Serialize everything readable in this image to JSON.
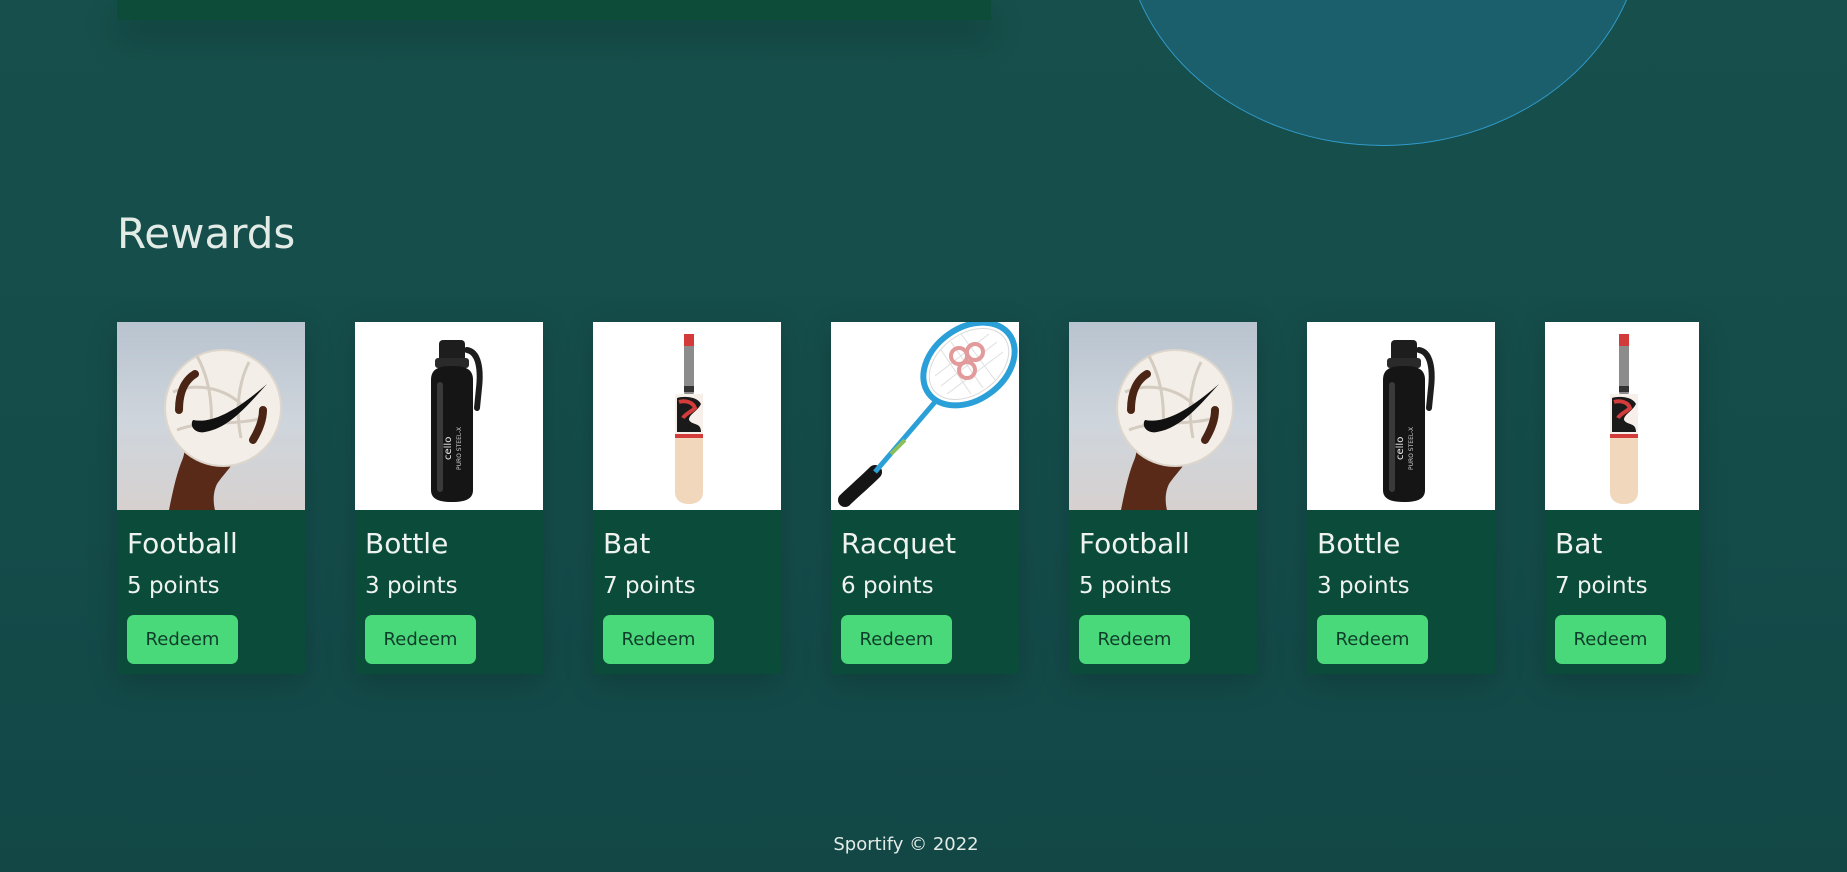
{
  "rewards": {
    "title": "Rewards",
    "items": [
      {
        "name": "Football",
        "points": "5 points",
        "button": "Redeem",
        "image": "football-image"
      },
      {
        "name": "Bottle",
        "points": "3 points",
        "button": "Redeem",
        "image": "bottle-image"
      },
      {
        "name": "Bat",
        "points": "7 points",
        "button": "Redeem",
        "image": "bat-image"
      },
      {
        "name": "Racquet",
        "points": "6 points",
        "button": "Redeem",
        "image": "racquet-image"
      },
      {
        "name": "Football",
        "points": "5 points",
        "button": "Redeem",
        "image": "football-image"
      },
      {
        "name": "Bottle",
        "points": "3 points",
        "button": "Redeem",
        "image": "bottle-image"
      },
      {
        "name": "Bat",
        "points": "7 points",
        "button": "Redeem",
        "image": "bat-image"
      }
    ]
  },
  "footer": {
    "text": "Sportify © 2022"
  },
  "colors": {
    "background": "#144d4a",
    "card": "#0b4b39",
    "button": "#49d97a",
    "circle": "#1c5f6c",
    "circle_border": "#2f9ac9"
  }
}
